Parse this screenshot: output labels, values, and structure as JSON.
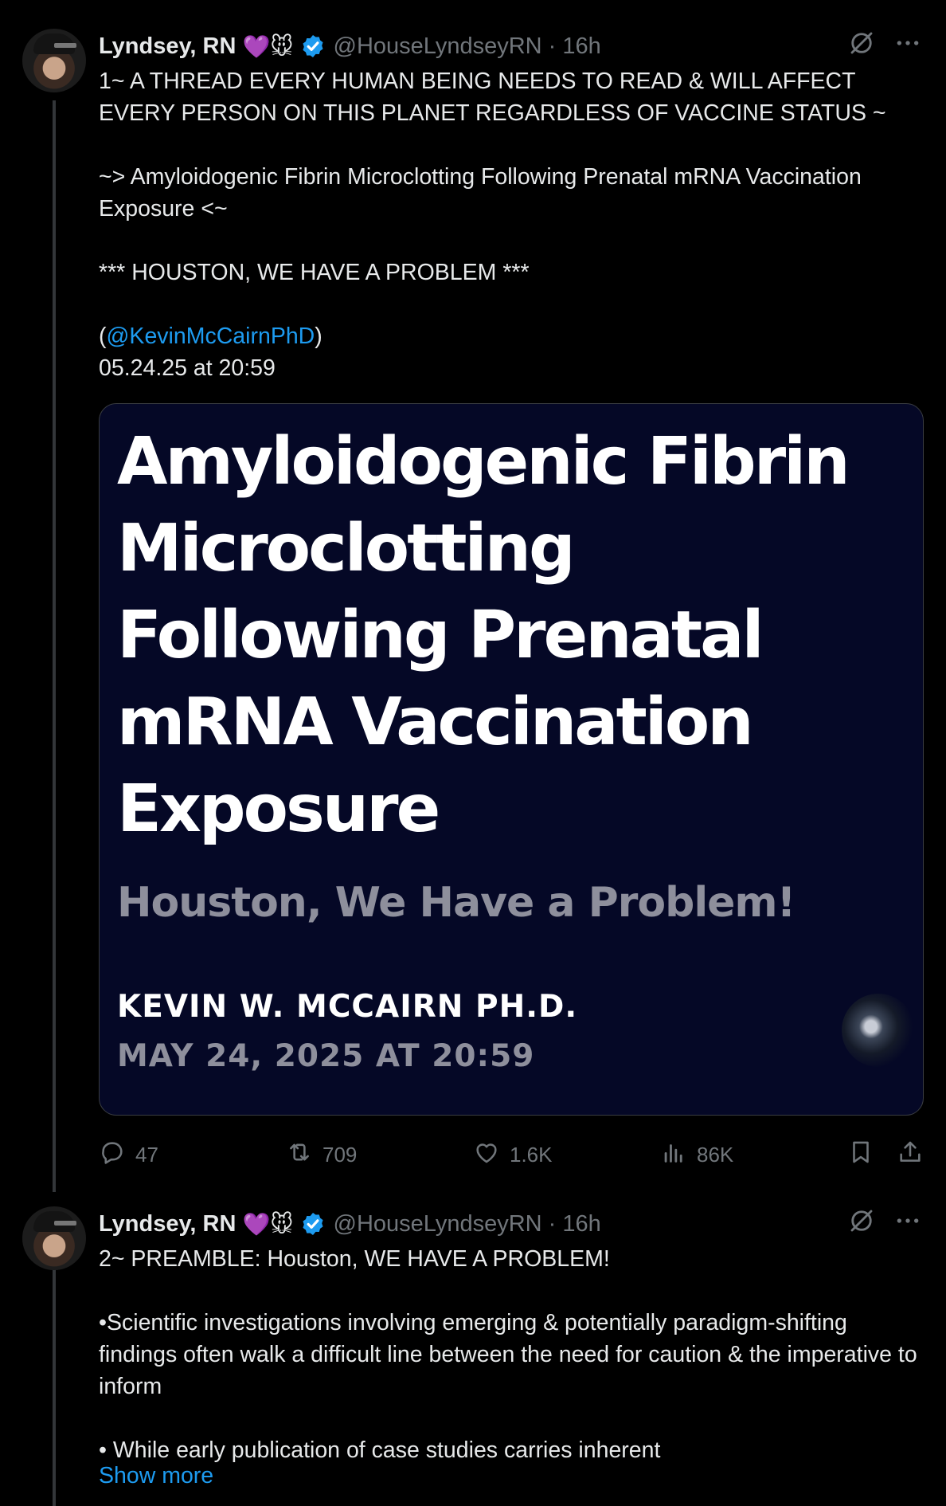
{
  "tweets": [
    {
      "name": "Lyndsey, RN",
      "emoji": "💜🐭",
      "handle": "@HouseLyndseyRN",
      "time": "· 16h",
      "text_1": "1~ A THREAD EVERY HUMAN BEING NEEDS TO READ & WILL AFFECT EVERY PERSON ON THIS PLANET REGARDLESS OF VACCINE STATUS ~\n\n~> Amyloidogenic Fibrin Microclotting Following Prenatal mRNA Vaccination Exposure <~\n\n*** HOUSTON, WE HAVE A PROBLEM ***\n\n(",
      "mention": "@KevinMcCairnPhD",
      "text_2": ")\n05.24.25 at 20:59",
      "card": {
        "title": "Amyloidogenic Fibrin Microclotting Following Prenatal mRNA Vaccination Exposure",
        "subtitle": "Houston, We Have a Problem!",
        "author": "KEVIN W. MCCAIRN PH.D.",
        "date": "MAY 24, 2025 AT 20:59"
      },
      "stats": {
        "replies": "47",
        "reposts": "709",
        "likes": "1.6K",
        "views": "86K"
      }
    },
    {
      "name": "Lyndsey, RN",
      "emoji": "💜🐭",
      "handle": "@HouseLyndseyRN",
      "time": "· 16h",
      "text": "2~ PREAMBLE: Houston, WE HAVE A PROBLEM!\n\n•Scientific investigations involving emerging & potentially paradigm-shifting findings often walk a difficult line between the need for caution & the imperative to inform\n\n• While early publication of case studies carries inherent",
      "show_more": "Show more"
    }
  ],
  "colors": {
    "background": "#000000",
    "text": "#e7e9ea",
    "secondary": "#71767b",
    "accent": "#1d9bf0",
    "card_background": "#050826"
  },
  "icons": [
    "verified-badge-icon",
    "grok-icon",
    "more-icon",
    "reply-icon",
    "repost-icon",
    "like-icon",
    "views-icon",
    "bookmark-icon",
    "share-icon"
  ]
}
